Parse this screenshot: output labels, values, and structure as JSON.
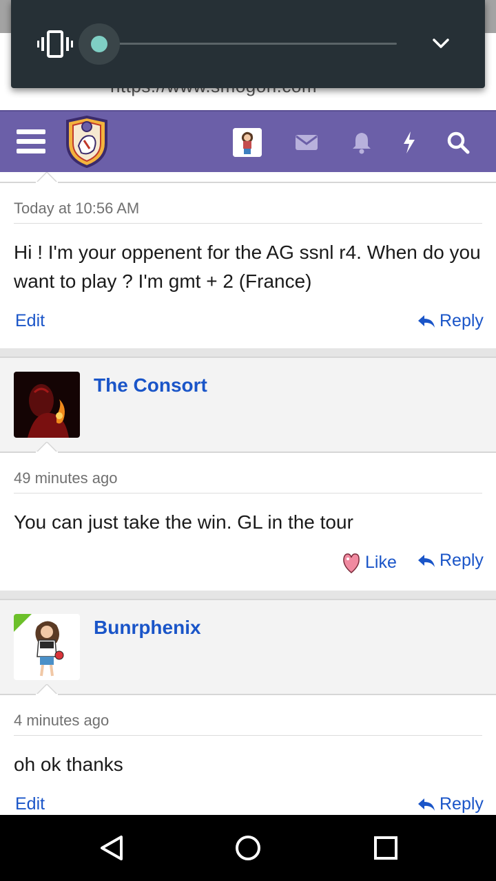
{
  "browser": {
    "url": "https://www.smogon.com"
  },
  "volume": {
    "mode_icon": "vibrate-icon",
    "level_pct": 0,
    "expand_icon": "chevron-down-icon"
  },
  "nav": {
    "icons": [
      "menu-icon",
      "smogon-logo",
      "avatar",
      "mail-icon",
      "bell-icon",
      "bolt-icon",
      "search-icon"
    ],
    "accent": "#6b5fa8"
  },
  "messages": [
    {
      "time": "Today at 10:56 AM",
      "text": "Hi ! I'm your oppenent for the AG ssnl r4. When do you want to play ? I'm gmt + 2 (France)",
      "edit": "Edit",
      "reply": "Reply"
    },
    {
      "author": "The Consort",
      "time": "49 minutes ago",
      "text": "You can just take the win. GL in the tour",
      "like": "Like",
      "reply": "Reply"
    },
    {
      "author": "Bunrphenix",
      "time": "4 minutes ago",
      "text": "oh ok thanks",
      "edit": "Edit",
      "reply": "Reply"
    }
  ],
  "sysnav": {
    "icons": [
      "back-icon",
      "home-icon",
      "recents-icon"
    ]
  }
}
